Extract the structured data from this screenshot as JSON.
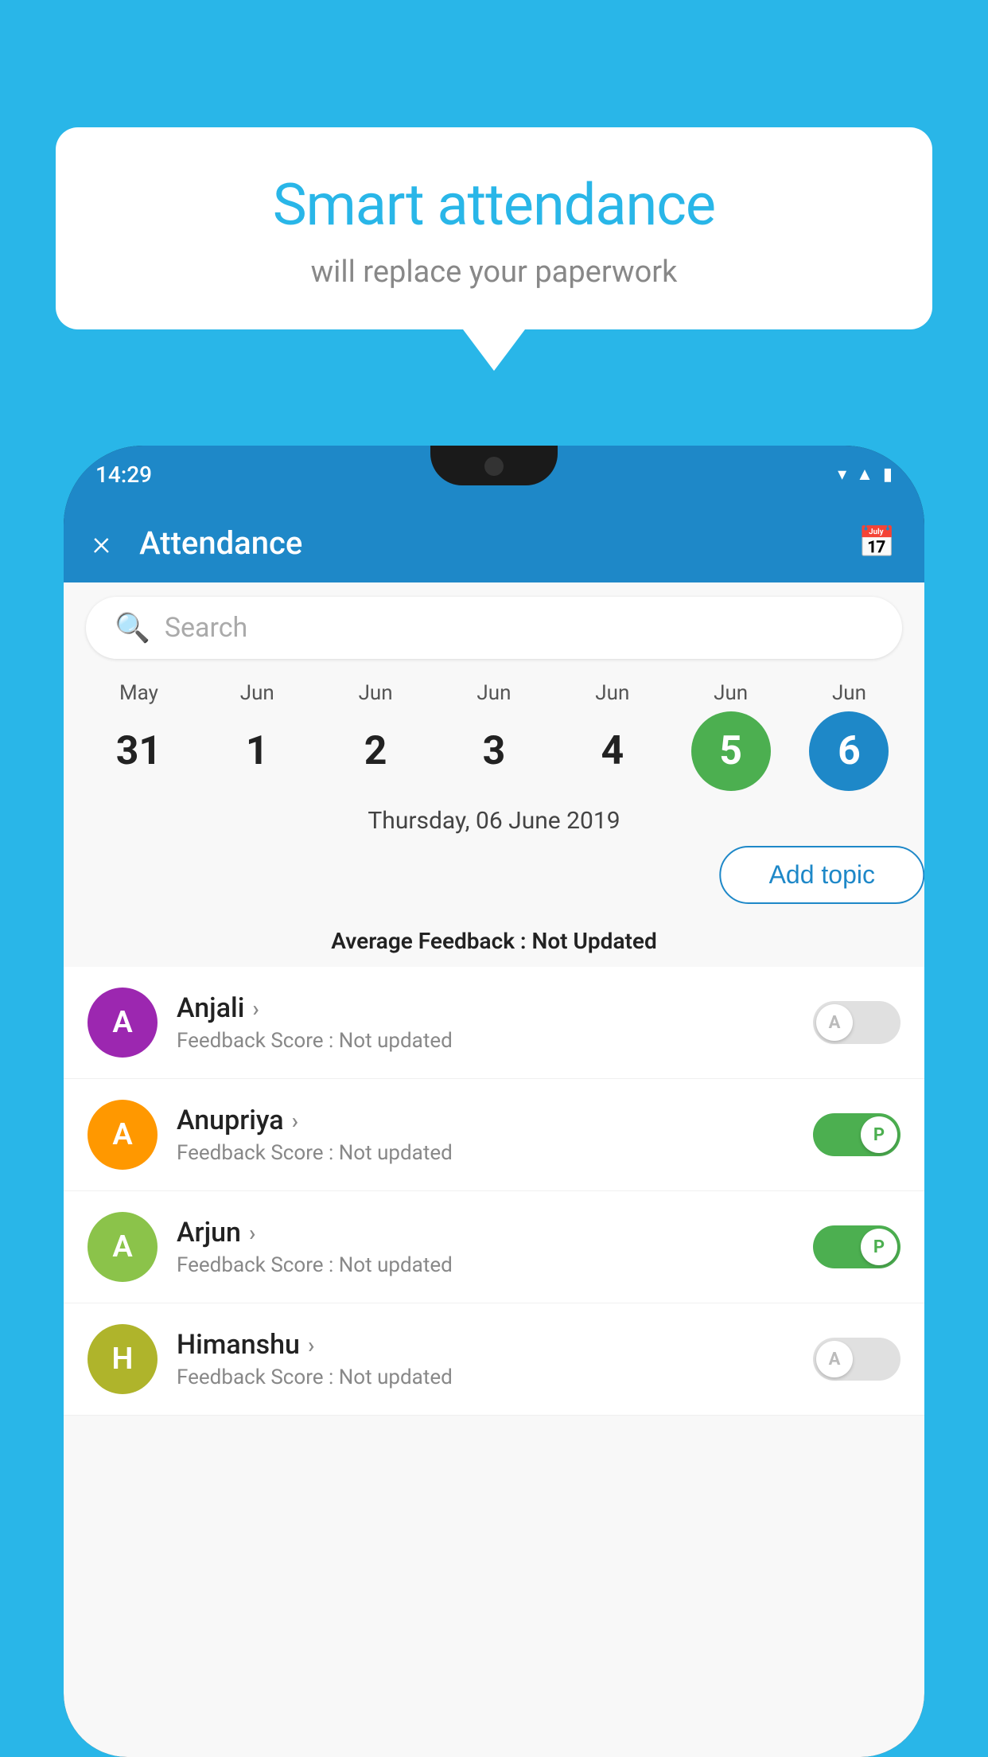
{
  "background_color": "#29b6e8",
  "bubble": {
    "title": "Smart attendance",
    "subtitle": "will replace your paperwork"
  },
  "status_bar": {
    "time": "14:29",
    "icons": [
      "wifi",
      "signal",
      "battery"
    ]
  },
  "app_bar": {
    "title": "Attendance",
    "close_label": "×",
    "calendar_icon": "📅"
  },
  "search": {
    "placeholder": "Search"
  },
  "calendar": {
    "days": [
      {
        "month": "May",
        "num": "31",
        "style": "normal"
      },
      {
        "month": "Jun",
        "num": "1",
        "style": "normal"
      },
      {
        "month": "Jun",
        "num": "2",
        "style": "normal"
      },
      {
        "month": "Jun",
        "num": "3",
        "style": "normal"
      },
      {
        "month": "Jun",
        "num": "4",
        "style": "normal"
      },
      {
        "month": "Jun",
        "num": "5",
        "style": "green"
      },
      {
        "month": "Jun",
        "num": "6",
        "style": "blue"
      }
    ]
  },
  "selected_date": "Thursday, 06 June 2019",
  "add_topic_label": "Add topic",
  "avg_feedback_label": "Average Feedback :",
  "avg_feedback_value": "Not Updated",
  "students": [
    {
      "name": "Anjali",
      "avatar_letter": "A",
      "avatar_color": "purple",
      "feedback_label": "Feedback Score :",
      "feedback_value": "Not updated",
      "toggle": "off",
      "toggle_letter": "A"
    },
    {
      "name": "Anupriya",
      "avatar_letter": "A",
      "avatar_color": "orange",
      "feedback_label": "Feedback Score :",
      "feedback_value": "Not updated",
      "toggle": "on",
      "toggle_letter": "P"
    },
    {
      "name": "Arjun",
      "avatar_letter": "A",
      "avatar_color": "light-green",
      "feedback_label": "Feedback Score :",
      "feedback_value": "Not updated",
      "toggle": "on",
      "toggle_letter": "P"
    },
    {
      "name": "Himanshu",
      "avatar_letter": "H",
      "avatar_color": "khaki",
      "feedback_label": "Feedback Score :",
      "feedback_value": "Not updated",
      "toggle": "off",
      "toggle_letter": "A"
    }
  ]
}
